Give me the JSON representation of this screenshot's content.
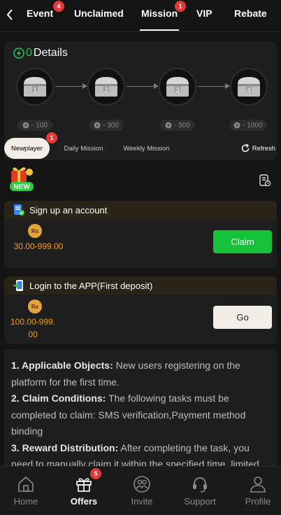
{
  "tabs": [
    {
      "label": "Event",
      "badge": "4"
    },
    {
      "label": "Unclaimed",
      "badge": ""
    },
    {
      "label": "Mission",
      "badge": "1"
    },
    {
      "label": "VIP",
      "badge": ""
    },
    {
      "label": "Rebate",
      "badge": ""
    }
  ],
  "details": {
    "count": "0",
    "title": "Details",
    "chests": [
      {
        "num": "1",
        "reward": "- 100"
      },
      {
        "num": "2",
        "reward": "- 300"
      },
      {
        "num": "3",
        "reward": "- 500"
      },
      {
        "num": "4",
        "reward": "- 1000"
      }
    ]
  },
  "subtabs": [
    {
      "label": "Newplayer",
      "badge": "1"
    },
    {
      "label": "Daily Mission"
    },
    {
      "label": "Weekly Mission"
    }
  ],
  "refresh_label": "Refresh",
  "new_label": "NEW",
  "tasks": [
    {
      "title": "Sign up an account",
      "coin": "Rs",
      "amount": "30.00-999.00",
      "button": "Claim"
    },
    {
      "title": "Login to the APP(First deposit)",
      "coin": "Rs",
      "amount": "100.00-999.00",
      "button": "Go"
    }
  ],
  "rules": {
    "r1_head": "1. Applicable Objects:",
    "r1_text": " New users registering on the platform for the first time.",
    "r2_head": "2. Claim Conditions:",
    "r2_text": " The following tasks must be completed to claim: SMS verification,Payment method binding",
    "r3_head": "3. Reward Distribution:",
    "r3_text": " After completing the task, you need to manually claim it within the specified time, limited"
  },
  "nav": [
    {
      "label": "Home"
    },
    {
      "label": "Offers",
      "badge": "5"
    },
    {
      "label": "Invite"
    },
    {
      "label": "Support"
    },
    {
      "label": "Profile"
    }
  ],
  "colors": {
    "accent_green": "#16c23a",
    "badge_red": "#e53935",
    "amount_orange": "#f59e0b"
  }
}
